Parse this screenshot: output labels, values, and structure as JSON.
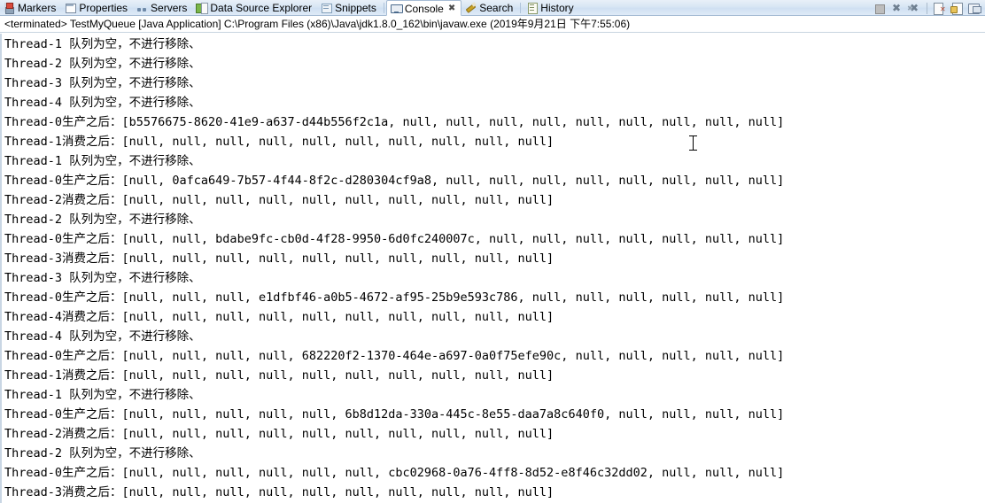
{
  "tabbar": {
    "tabs": [
      {
        "label": "Markers",
        "icon": "markers-icon",
        "active": false,
        "closable": false
      },
      {
        "label": "Properties",
        "icon": "properties-icon",
        "active": false,
        "closable": false
      },
      {
        "label": "Servers",
        "icon": "servers-icon",
        "active": false,
        "closable": false
      },
      {
        "label": "Data Source Explorer",
        "icon": "data-source-explorer-icon",
        "active": false,
        "closable": false
      },
      {
        "label": "Snippets",
        "icon": "snippets-icon",
        "active": false,
        "closable": false
      },
      {
        "label": "Console",
        "icon": "console-icon",
        "active": true,
        "closable": true
      },
      {
        "label": "Search",
        "icon": "search-icon",
        "active": false,
        "closable": false
      },
      {
        "label": "History",
        "icon": "history-icon",
        "active": false,
        "closable": false
      }
    ],
    "close_glyph": "✖"
  },
  "toolbar": {
    "buttons": [
      {
        "name": "terminate-button",
        "title": "Terminate"
      },
      {
        "name": "remove-all-terminated-button",
        "title": "Remove All Terminated Launches"
      },
      {
        "name": "remove-launch-button",
        "title": "Remove Launch"
      },
      {
        "name": "clear-console-button",
        "title": "Clear Console"
      },
      {
        "name": "scroll-lock-button",
        "title": "Scroll Lock"
      },
      {
        "name": "pin-console-button",
        "title": "Pin Console"
      }
    ]
  },
  "process_header": {
    "text": "<terminated> TestMyQueue [Java Application] C:\\Program Files (x86)\\Java\\jdk1.8.0_162\\bin\\javaw.exe (2019年9月21日 下午7:55:06)",
    "status": "<terminated>",
    "launch_name": "TestMyQueue",
    "launch_type": "[Java Application]",
    "jvm_path": "C:\\Program Files (x86)\\Java\\jdk1.8.0_162\\bin\\javaw.exe",
    "timestamp": "(2019年9月21日 下午7:55:06)"
  },
  "console": {
    "colors": {
      "background": "#ffffff",
      "text": "#000000",
      "tab_active_bg": "#ffffff"
    },
    "lines": [
      "Thread-1 队列为空，不进行移除、",
      "Thread-2 队列为空，不进行移除、",
      "Thread-3 队列为空，不进行移除、",
      "Thread-4 队列为空，不进行移除、",
      "Thread-0生产之后：[b5576675-8620-41e9-a637-d44b556f2c1a, null, null, null, null, null, null, null, null, null]",
      "Thread-1消费之后：[null, null, null, null, null, null, null, null, null, null]",
      "Thread-1 队列为空，不进行移除、",
      "Thread-0生产之后：[null, 0afca649-7b57-4f44-8f2c-d280304cf9a8, null, null, null, null, null, null, null, null]",
      "Thread-2消费之后：[null, null, null, null, null, null, null, null, null, null]",
      "Thread-2 队列为空，不进行移除、",
      "Thread-0生产之后：[null, null, bdabe9fc-cb0d-4f28-9950-6d0fc240007c, null, null, null, null, null, null, null]",
      "Thread-3消费之后：[null, null, null, null, null, null, null, null, null, null]",
      "Thread-3 队列为空，不进行移除、",
      "Thread-0生产之后：[null, null, null, e1dfbf46-a0b5-4672-af95-25b9e593c786, null, null, null, null, null, null]",
      "Thread-4消费之后：[null, null, null, null, null, null, null, null, null, null]",
      "Thread-4 队列为空，不进行移除、",
      "Thread-0生产之后：[null, null, null, null, 682220f2-1370-464e-a697-0a0f75efe90c, null, null, null, null, null]",
      "Thread-1消费之后：[null, null, null, null, null, null, null, null, null, null]",
      "Thread-1 队列为空，不进行移除、",
      "Thread-0生产之后：[null, null, null, null, null, 6b8d12da-330a-445c-8e55-daa7a8c640f0, null, null, null, null]",
      "Thread-2消费之后：[null, null, null, null, null, null, null, null, null, null]",
      "Thread-2 队列为空，不进行移除、",
      "Thread-0生产之后：[null, null, null, null, null, null, cbc02968-0a76-4ff8-8d52-e8f46c32dd02, null, null, null]",
      "Thread-3消费之后：[null, null, null, null, null, null, null, null, null, null]"
    ]
  }
}
